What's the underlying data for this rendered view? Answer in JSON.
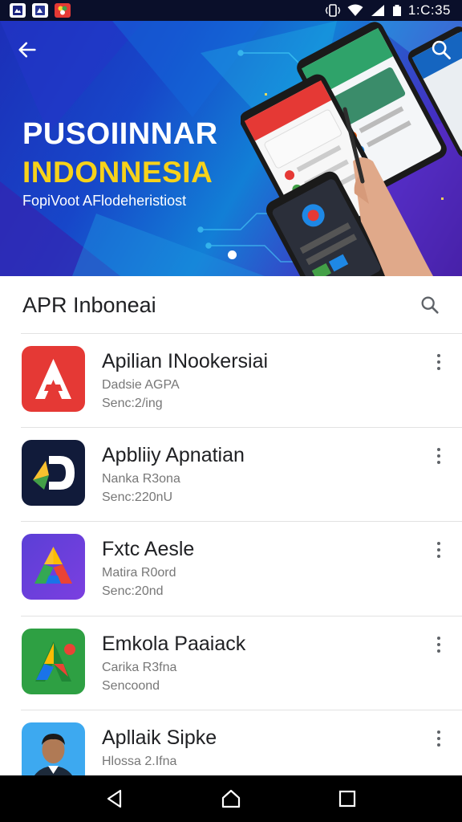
{
  "status_bar": {
    "time": "1:C:35",
    "notification_icons": [
      "gallery-icon",
      "gallery-icon",
      "photos-icon"
    ],
    "system_icons": [
      "vibrate-icon",
      "wifi-icon",
      "signal-icon",
      "battery-icon"
    ]
  },
  "hero": {
    "title": "PUSOIINNAR",
    "subtitle": "INDONNESIA",
    "tagline": "FopiVoot AFlodeheristiost",
    "carousel_position": 1,
    "colors": {
      "title": "#ffffff",
      "subtitle": "#f7d21a",
      "background": "#1746c9"
    }
  },
  "section": {
    "title": "APR Inboneai"
  },
  "apps": [
    {
      "name": "Apilian INookersiai",
      "meta1": "Dadsie AGPA",
      "meta2": "Senc:2/ing",
      "icon": "red-a-logo-icon"
    },
    {
      "name": "Apbliiy Apnatian",
      "meta1": "Nanka R3ona",
      "meta2": "Senc:220nU",
      "icon": "navy-d-logo-icon"
    },
    {
      "name": "Fxtc Aesle",
      "meta1": "Matira R0ord",
      "meta2": "Senc:20nd",
      "icon": "purple-a-logo-icon"
    },
    {
      "name": "Emkola Paaiack",
      "meta1": "Carika R3fna",
      "meta2": "Sencoond",
      "icon": "green-a-logo-icon"
    },
    {
      "name": "Apllaik Sipke",
      "meta1": "Hlossa 2.Ifna",
      "meta2": "",
      "icon": "person-avatar-icon"
    }
  ]
}
